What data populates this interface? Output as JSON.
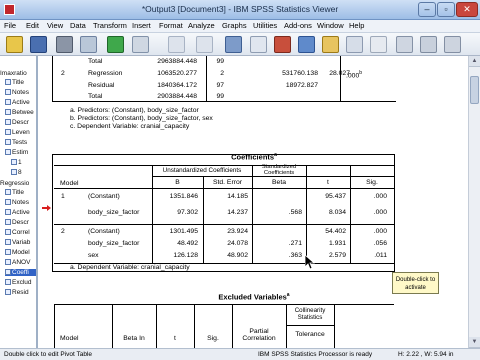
{
  "window": {
    "title": "*Output3 [Document3] - IBM SPSS Statistics Viewer",
    "min": "–",
    "max": "▫",
    "close": "✕"
  },
  "menu": [
    "File",
    "Edit",
    "View",
    "Data",
    "Transform",
    "Insert",
    "Format",
    "Analyze",
    "Graphs",
    "Utilities",
    "Add-ons",
    "Window",
    "Help"
  ],
  "outline": [
    "Imaxratio",
    "Title",
    "Notes",
    "Active",
    "Betwee",
    "Descr",
    "Leven",
    "Tests",
    "Estim",
    "1",
    "8",
    "Regressio",
    "Title",
    "Notes",
    "Active",
    "Descr",
    "Correl",
    "Variab",
    "Model",
    "ANOV",
    "Coeffi",
    "Exclud",
    "Resid"
  ],
  "anova_partial": {
    "row0": {
      "label": "Total",
      "ss": "2963884.448",
      "df": "99"
    },
    "row1": {
      "model": "2",
      "label": "Regression",
      "ss": "1063520.277",
      "df": "2",
      "ms": "531760.138",
      "f": "28.027",
      "sig": ".000",
      "sig_sup": "b"
    },
    "row2": {
      "label": "Residual",
      "ss": "1840364.172",
      "df": "97",
      "ms": "18972.827"
    },
    "row3": {
      "label": "Total",
      "ss": "2903884.448",
      "df": "99"
    },
    "notes": [
      "a. Predictors: (Constant), body_size_factor",
      "b. Predictors: (Constant), body_size_factor, sex",
      "c. Dependent Variable: cranial_capacity"
    ]
  },
  "coefficients": {
    "title": "Coefficients",
    "title_sup": "a",
    "h_model": "Model",
    "h_unstd": "Unstandardized Coefficients",
    "h_std": "Standardized Coefficients",
    "h_b": "B",
    "h_se": "Std. Error",
    "h_beta": "Beta",
    "h_t": "t",
    "h_sig": "Sig.",
    "rows": [
      {
        "model": "1",
        "term": "(Constant)",
        "b": "1351.846",
        "se": "14.185",
        "beta": "",
        "t": "95.437",
        "sig": ".000"
      },
      {
        "model": "",
        "term": "body_size_factor",
        "b": "97.302",
        "se": "14.237",
        "beta": ".568",
        "t": "8.034",
        "sig": ".000"
      },
      {
        "model": "2",
        "term": "(Constant)",
        "b": "1301.495",
        "se": "23.924",
        "beta": "",
        "t": "54.402",
        "sig": ".000"
      },
      {
        "model": "",
        "term": "body_size_factor",
        "b": "48.492",
        "se": "24.078",
        "beta": ".271",
        "t": "1.931",
        "sig": ".056"
      },
      {
        "model": "",
        "term": "sex",
        "b": "126.128",
        "se": "48.902",
        "beta": ".363",
        "t": "2.579",
        "sig": ".011"
      }
    ],
    "note": "a. Dependent Variable: cranial_capacity"
  },
  "excluded": {
    "title": "Excluded Variables",
    "title_sup": "a",
    "h_model": "Model",
    "h_beta_in": "Beta In",
    "h_t": "t",
    "h_sig": "Sig.",
    "h_partial": "Partial Correlation",
    "h_collin": "Collinearity Statistics",
    "h_tol": "Tolerance"
  },
  "tooltip": {
    "line1": "Double-click to",
    "line2": "activate"
  },
  "status": {
    "left": "Double click to edit Pivot Table",
    "mid": "IBM SPSS Statistics Processor is ready",
    "right": "H: 2.22 , W: 5.94 in"
  }
}
